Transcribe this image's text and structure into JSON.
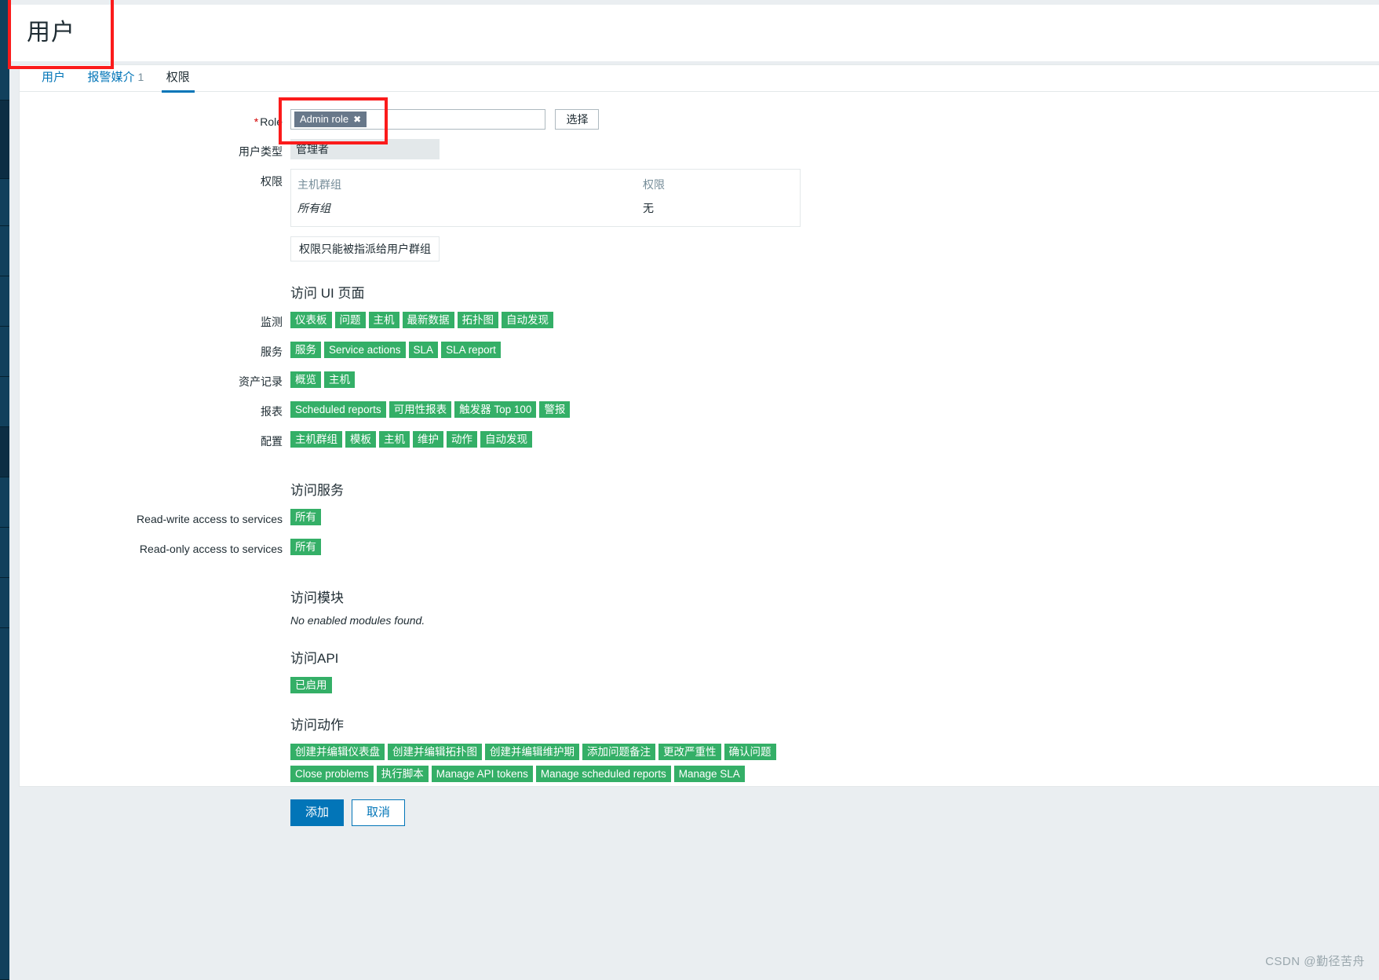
{
  "header": {
    "title": "用户"
  },
  "tabs": [
    {
      "label": "用户",
      "count": "",
      "active": false
    },
    {
      "label": "报警媒介",
      "count": "1",
      "active": false
    },
    {
      "label": "权限",
      "count": "",
      "active": true
    }
  ],
  "form": {
    "role": {
      "label": "Role",
      "required_marker": "*",
      "chip": "Admin role",
      "chip_remove_icon": "✖",
      "select_button": "选择"
    },
    "user_type": {
      "label": "用户类型",
      "value": "管理者"
    },
    "permissions": {
      "label": "权限",
      "columns": [
        "主机群组",
        "权限"
      ],
      "rows": [
        {
          "group": "所有组",
          "permission": "无"
        }
      ],
      "note": "权限只能被指派给用户群组"
    }
  },
  "ui_access": {
    "heading": "访问 UI 页面",
    "groups": [
      {
        "label": "监测",
        "tags": [
          "仪表板",
          "问题",
          "主机",
          "最新数据",
          "拓扑图",
          "自动发现"
        ]
      },
      {
        "label": "服务",
        "tags": [
          "服务",
          "Service actions",
          "SLA",
          "SLA report"
        ]
      },
      {
        "label": "资产记录",
        "tags": [
          "概览",
          "主机"
        ]
      },
      {
        "label": "报表",
        "tags": [
          "Scheduled reports",
          "可用性报表",
          "触发器 Top 100",
          "警报"
        ]
      },
      {
        "label": "配置",
        "tags": [
          "主机群组",
          "模板",
          "主机",
          "维护",
          "动作",
          "自动发现"
        ]
      }
    ]
  },
  "services_access": {
    "heading": "访问服务",
    "rows": [
      {
        "label": "Read-write access to services",
        "tags": [
          "所有"
        ]
      },
      {
        "label": "Read-only access to services",
        "tags": [
          "所有"
        ]
      }
    ]
  },
  "modules_access": {
    "heading": "访问模块",
    "empty_text": "No enabled modules found."
  },
  "api_access": {
    "heading": "访问API",
    "tags": [
      "已启用"
    ]
  },
  "actions_access": {
    "heading": "访问动作",
    "rows": [
      [
        "创建并编辑仪表盘",
        "创建并编辑拓扑图",
        "创建并编辑维护期",
        "添加问题备注",
        "更改严重性",
        "确认问题"
      ],
      [
        "Close problems",
        "执行脚本",
        "Manage API tokens",
        "Manage scheduled reports",
        "Manage SLA"
      ]
    ]
  },
  "footer_buttons": {
    "submit": "添加",
    "cancel": "取消"
  },
  "watermark": "CSDN @勤径苦舟",
  "colors": {
    "accent_blue": "#0275b8",
    "tag_green": "#34af67",
    "chip_gray": "#68788a",
    "annotation_red": "#fb1b1b",
    "nav_dark": "#0d4a70",
    "page_bg": "#eaeef1"
  }
}
